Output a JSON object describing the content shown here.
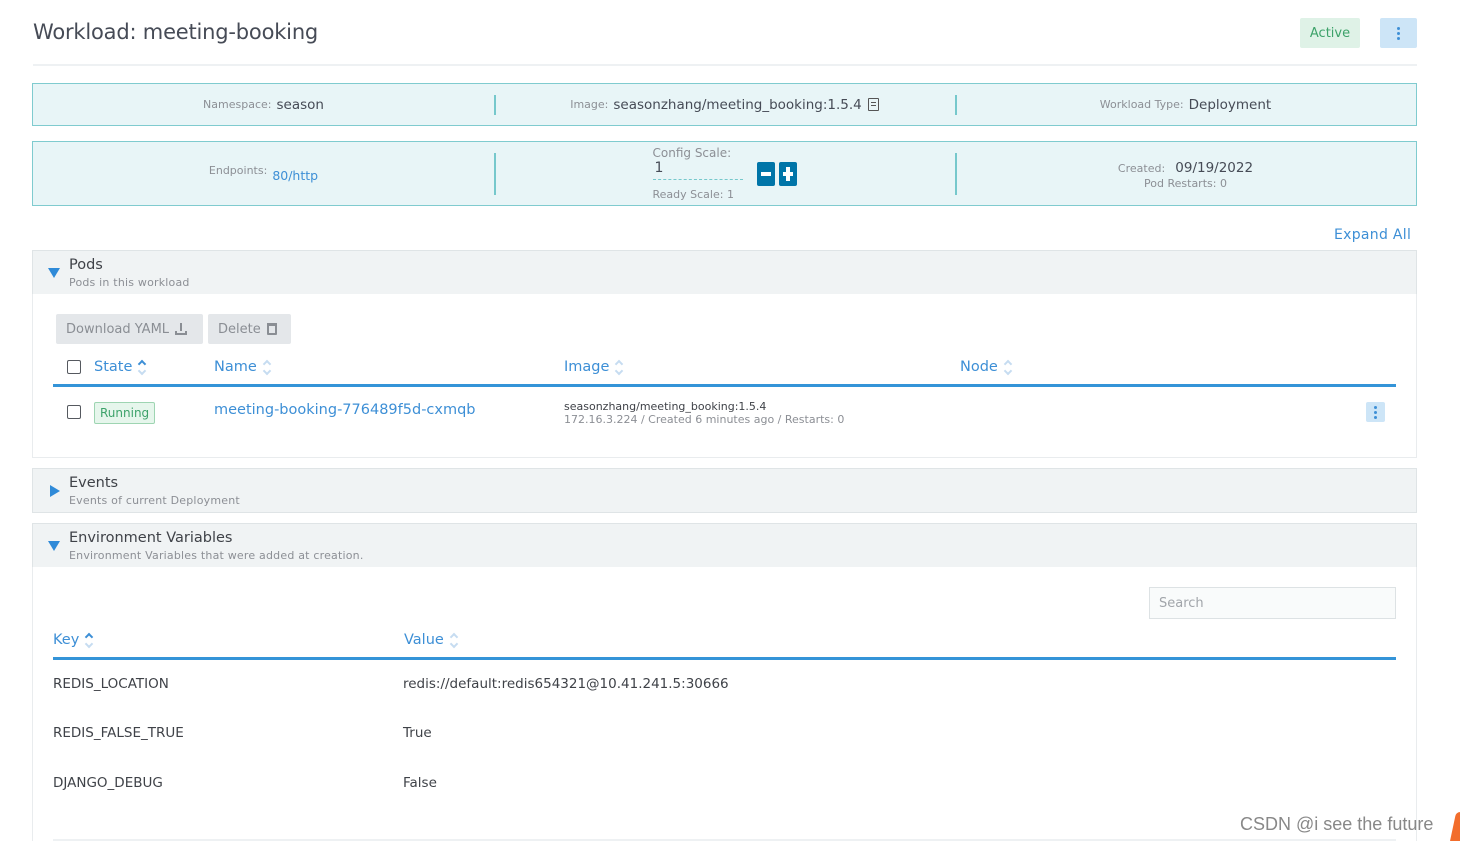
{
  "header": {
    "title": "Workload: meeting-booking",
    "status": "Active",
    "colors": {
      "status_bg": "#dff2e7",
      "status_text": "#3da26a",
      "accent": "#3d8fd6"
    }
  },
  "info_row1": {
    "namespace_label": "Namespace:",
    "namespace_value": "season",
    "image_label": "Image:",
    "image_value": "seasonzhang/meeting_booking:1.5.4",
    "workload_type_label": "Workload Type:",
    "workload_type_value": "Deployment"
  },
  "info_row2": {
    "endpoints_label": "Endpoints:",
    "endpoints_value": "80/http",
    "config_scale_label": "Config Scale:",
    "config_scale_value": "1",
    "ready_scale_label": "Ready Scale:",
    "ready_scale_value": "1",
    "created_label": "Created:",
    "created_value": "09/19/2022",
    "pod_restarts_label": "Pod Restarts:",
    "pod_restarts_value": "0"
  },
  "expand_all": "Expand All",
  "pods_section": {
    "title": "Pods",
    "subtitle": "Pods in this workload",
    "expanded": true,
    "download_yaml_label": "Download YAML",
    "delete_label": "Delete",
    "columns": [
      "State",
      "Name",
      "Image",
      "Node"
    ],
    "rows": [
      {
        "state": "Running",
        "name": "meeting-booking-776489f5d-cxmqb",
        "image": "seasonzhang/meeting_booking:1.5.4",
        "meta": "172.16.3.224 / Created 6 minutes ago / Restarts: 0",
        "node": ""
      }
    ]
  },
  "events_section": {
    "title": "Events",
    "subtitle": "Events of current Deployment",
    "expanded": false
  },
  "env_section": {
    "title": "Environment Variables",
    "subtitle": "Environment Variables that were added at creation.",
    "expanded": true,
    "search_placeholder": "Search",
    "search_value": "",
    "columns": [
      "Key",
      "Value"
    ],
    "rows": [
      {
        "key": "REDIS_LOCATION",
        "value": "redis://default:redis654321@10.41.241.5:30666"
      },
      {
        "key": "REDIS_FALSE_TRUE",
        "value": "True"
      },
      {
        "key": "DJANGO_DEBUG",
        "value": "False"
      }
    ]
  },
  "watermark": "CSDN @i see the future"
}
